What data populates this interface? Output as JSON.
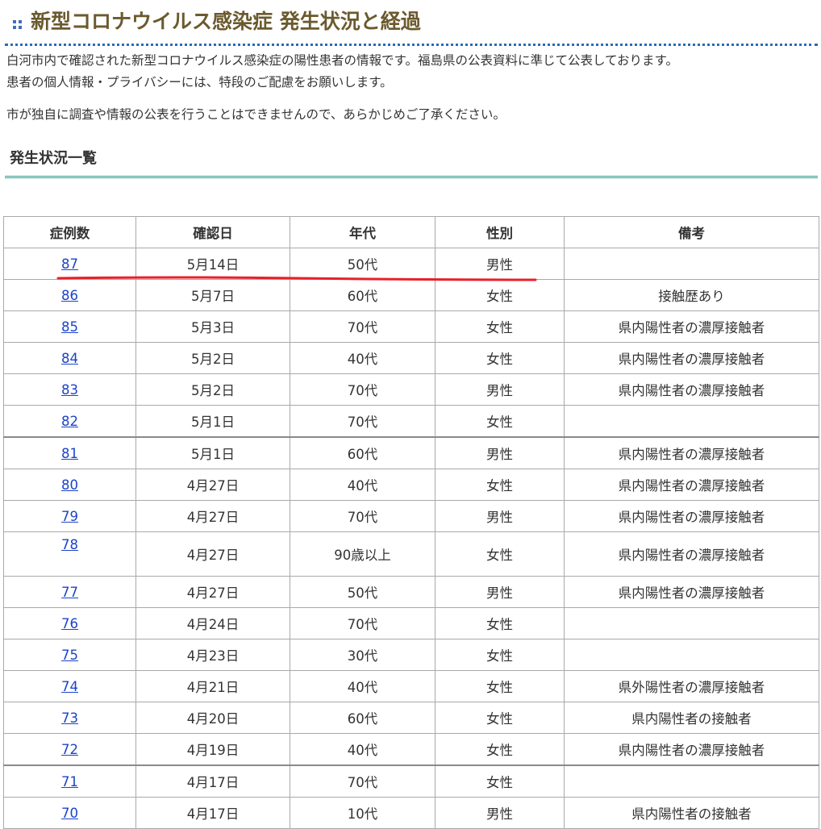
{
  "header": {
    "title": "新型コロナウイルス感染症 発生状況と経過"
  },
  "intro": {
    "line1": "白河市内で確認された新型コロナウイルス感染症の陽性患者の情報です。福島県の公表資料に準じて公表しております。",
    "line2": "患者の個人情報・プライバシーには、特段のご配慮をお願いします。",
    "line3": "市が独自に調査や情報の公表を行うことはできませんので、あらかじめご了承ください。"
  },
  "section": {
    "title": "発生状況一覧"
  },
  "table": {
    "headers": [
      "症例数",
      "確認日",
      "年代",
      "性別",
      "備考"
    ],
    "rows": [
      {
        "no": "87",
        "date": "5月14日",
        "age": "50代",
        "sex": "男性",
        "note": ""
      },
      {
        "no": "86",
        "date": "5月7日",
        "age": "60代",
        "sex": "女性",
        "note": "接触歴あり"
      },
      {
        "no": "85",
        "date": "5月3日",
        "age": "70代",
        "sex": "女性",
        "note": "県内陽性者の濃厚接触者"
      },
      {
        "no": "84",
        "date": "5月2日",
        "age": "40代",
        "sex": "女性",
        "note": "県内陽性者の濃厚接触者"
      },
      {
        "no": "83",
        "date": "5月2日",
        "age": "70代",
        "sex": "男性",
        "note": "県内陽性者の濃厚接触者"
      },
      {
        "no": "82",
        "date": "5月1日",
        "age": "70代",
        "sex": "女性",
        "note": ""
      },
      {
        "no": "81",
        "date": "5月1日",
        "age": "60代",
        "sex": "男性",
        "note": "県内陽性者の濃厚接触者"
      },
      {
        "no": "80",
        "date": "4月27日",
        "age": "40代",
        "sex": "女性",
        "note": "県内陽性者の濃厚接触者"
      },
      {
        "no": "79",
        "date": "4月27日",
        "age": "70代",
        "sex": "男性",
        "note": "県内陽性者の濃厚接触者"
      },
      {
        "no": "78",
        "date": "4月27日",
        "age": "90歳以上",
        "sex": "女性",
        "note": "県内陽性者の濃厚接触者"
      },
      {
        "no": "77",
        "date": "4月27日",
        "age": "50代",
        "sex": "男性",
        "note": "県内陽性者の濃厚接触者"
      },
      {
        "no": "76",
        "date": "4月24日",
        "age": "70代",
        "sex": "女性",
        "note": ""
      },
      {
        "no": "75",
        "date": "4月23日",
        "age": "30代",
        "sex": "女性",
        "note": ""
      },
      {
        "no": "74",
        "date": "4月21日",
        "age": "40代",
        "sex": "女性",
        "note": "県外陽性者の濃厚接触者"
      },
      {
        "no": "73",
        "date": "4月20日",
        "age": "60代",
        "sex": "女性",
        "note": "県内陽性者の接触者"
      },
      {
        "no": "72",
        "date": "4月19日",
        "age": "40代",
        "sex": "女性",
        "note": "県内陽性者の濃厚接触者"
      },
      {
        "no": "71",
        "date": "4月17日",
        "age": "70代",
        "sex": "女性",
        "note": ""
      },
      {
        "no": "70",
        "date": "4月17日",
        "age": "10代",
        "sex": "男性",
        "note": "県内陽性者の接触者"
      }
    ]
  },
  "annotation": {
    "underline_color": "#e8202a"
  }
}
